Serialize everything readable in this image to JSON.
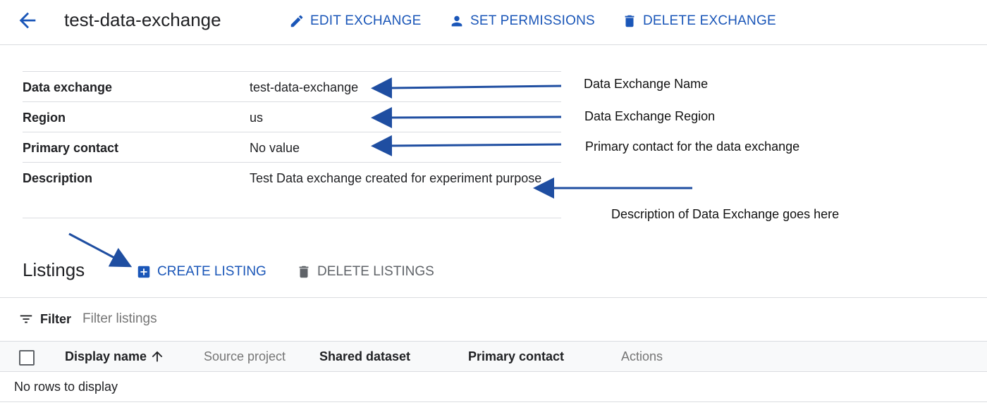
{
  "header": {
    "title": "test-data-exchange",
    "actions": {
      "edit": "EDIT EXCHANGE",
      "permissions": "SET PERMISSIONS",
      "delete": "DELETE EXCHANGE"
    }
  },
  "details": [
    {
      "key": "Data exchange",
      "value": "test-data-exchange"
    },
    {
      "key": "Region",
      "value": "us"
    },
    {
      "key": "Primary contact",
      "value": "No value"
    },
    {
      "key": "Description",
      "value": "Test Data exchange created for experiment purpose"
    }
  ],
  "annotations": {
    "name": "Data Exchange Name",
    "region": "Data Exchange Region",
    "contact": "Primary contact for the data exchange",
    "description": "Description of Data Exchange goes here"
  },
  "listings": {
    "title": "Listings",
    "create": "CREATE LISTING",
    "delete": "DELETE LISTINGS"
  },
  "filter": {
    "label": "Filter",
    "placeholder": "Filter listings"
  },
  "table": {
    "columns": [
      "Display name",
      "Source project",
      "Shared dataset",
      "Primary contact",
      "Actions"
    ],
    "empty": "No rows to display"
  },
  "colors": {
    "accent": "#1a56b8",
    "arrow": "#1f4ea1",
    "muted": "#757575"
  }
}
